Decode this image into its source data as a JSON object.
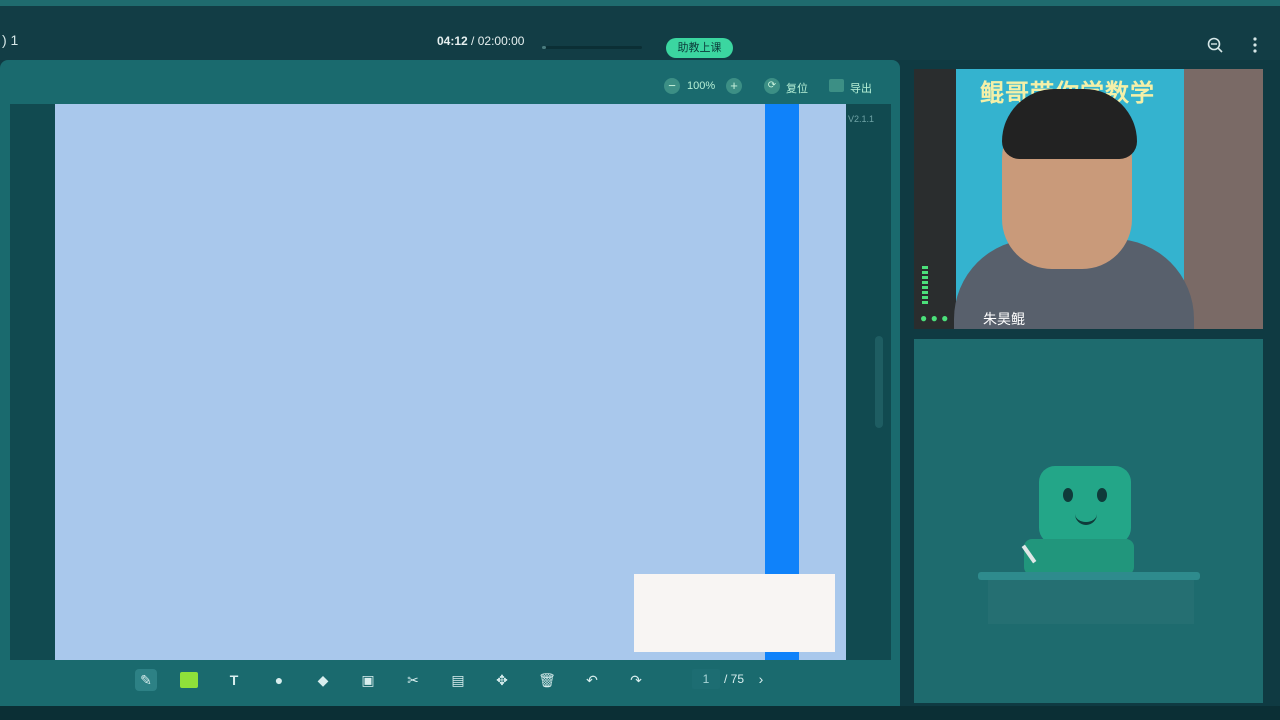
{
  "topbar": {
    "left_count": ") 1",
    "timer_elapsed": "04:12",
    "timer_separator": " / ",
    "timer_total": "02:00:00",
    "progress_fraction": 0.035,
    "assistant_button": "助教上课",
    "right_icons": [
      "search-icon",
      "more-vertical-icon"
    ]
  },
  "board": {
    "zoom_value": "100%",
    "reset_label": "复位",
    "export_label": "导出",
    "version": "V2.1.1"
  },
  "bottom_toolbar": {
    "tools": [
      "pen-icon",
      "color-swatch",
      "text-icon",
      "shape-icon",
      "eraser-icon",
      "screenshot-icon",
      "scissors-icon",
      "image-icon",
      "move-icon",
      "delete-icon",
      "undo-icon",
      "redo-icon"
    ],
    "current_page": "1",
    "total_pages": "/ 75"
  },
  "video": {
    "banner_text": "鲲哥带你学数学",
    "teacher_name": "朱昊鲲"
  },
  "colors": {
    "accent": "#3bd6a0",
    "panel": "#1a6a6e",
    "slide_bg": "#a9c8ec",
    "slide_bar": "#0f82fa",
    "swatch": "#8fe03a"
  }
}
